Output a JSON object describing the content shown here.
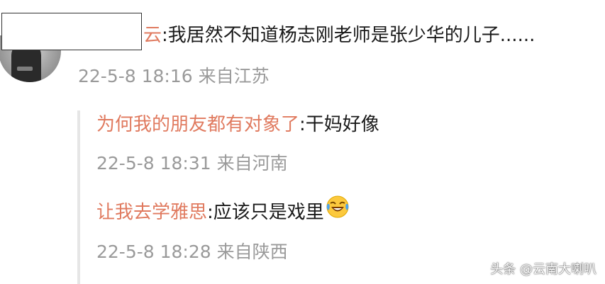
{
  "main_comment": {
    "username": "云",
    "separator": ":",
    "text": "我居然不知道杨志刚老师是张少华的儿子......",
    "timestamp": "22-5-8 18:16",
    "location": "来自江苏"
  },
  "replies": [
    {
      "username": "为何我的朋友都有对象了",
      "separator": ":",
      "text": "干妈好像",
      "timestamp": "22-5-8 18:31",
      "location": "来自河南"
    },
    {
      "username": "让我去学雅思",
      "separator": ":",
      "text": "应该只是戏里",
      "emoji": "laughing-crying-emoji",
      "timestamp": "22-5-8 18:28",
      "location": "来自陕西"
    }
  ],
  "watermark": "头条 @云南大喇叭",
  "colors": {
    "username": "#e07a5f",
    "meta": "#9a9a9a",
    "text": "#1a1a1a"
  }
}
